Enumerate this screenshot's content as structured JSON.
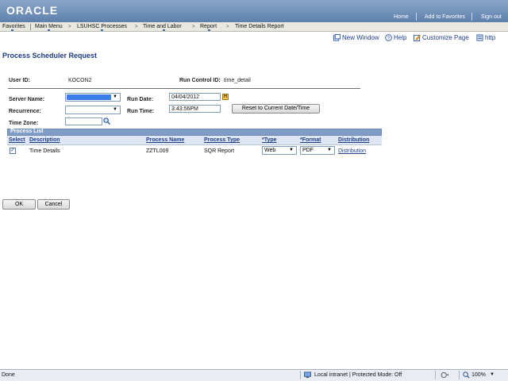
{
  "header": {
    "logo": "ORACLE",
    "links": [
      "Home",
      "Add to Favorites",
      "Sign out"
    ]
  },
  "menubar": {
    "items": [
      "Favorites",
      "Main Menu",
      "LSUHSC Processes",
      "Time and Labor",
      "Report",
      "Time Details Report"
    ]
  },
  "tools": {
    "new_window": "New Window",
    "help": "Help",
    "customize_page": "Customize Page",
    "http": "http"
  },
  "page": {
    "title": "Process Scheduler Request"
  },
  "form": {
    "user_id_label": "User ID:",
    "user_id_value": "KOCON2",
    "run_control_label": "Run Control ID:",
    "run_control_value": "time_detail",
    "server_name_label": "Server Name:",
    "recurrence_label": "Recurrence:",
    "time_zone_label": "Time Zone:",
    "run_date_label": "Run Date:",
    "run_date_value": "04/04/2012",
    "run_time_label": "Run Time:",
    "run_time_value": "3:43:56PM",
    "reset_button": "Reset to Current Date/Time"
  },
  "process_list": {
    "title": "Process List",
    "columns": [
      "Select",
      "Description",
      "Process Name",
      "Process Type",
      "*Type",
      "*Format",
      "Distribution"
    ],
    "rows": [
      {
        "selected": true,
        "description": "Time Details",
        "process_name": "ZZTL009",
        "process_type": "SQR Report",
        "type": "Web",
        "format": "PDF",
        "distribution": "Distribution"
      }
    ]
  },
  "actions": {
    "ok": "OK",
    "cancel": "Cancel"
  },
  "statusbar": {
    "status": "Done",
    "zone": "Local intranet | Protected Mode: Off",
    "zoom": "100%"
  },
  "colors": {
    "accent": "#1f3c88",
    "header": "#6e8fb8",
    "selection": "#3a7ee8"
  }
}
